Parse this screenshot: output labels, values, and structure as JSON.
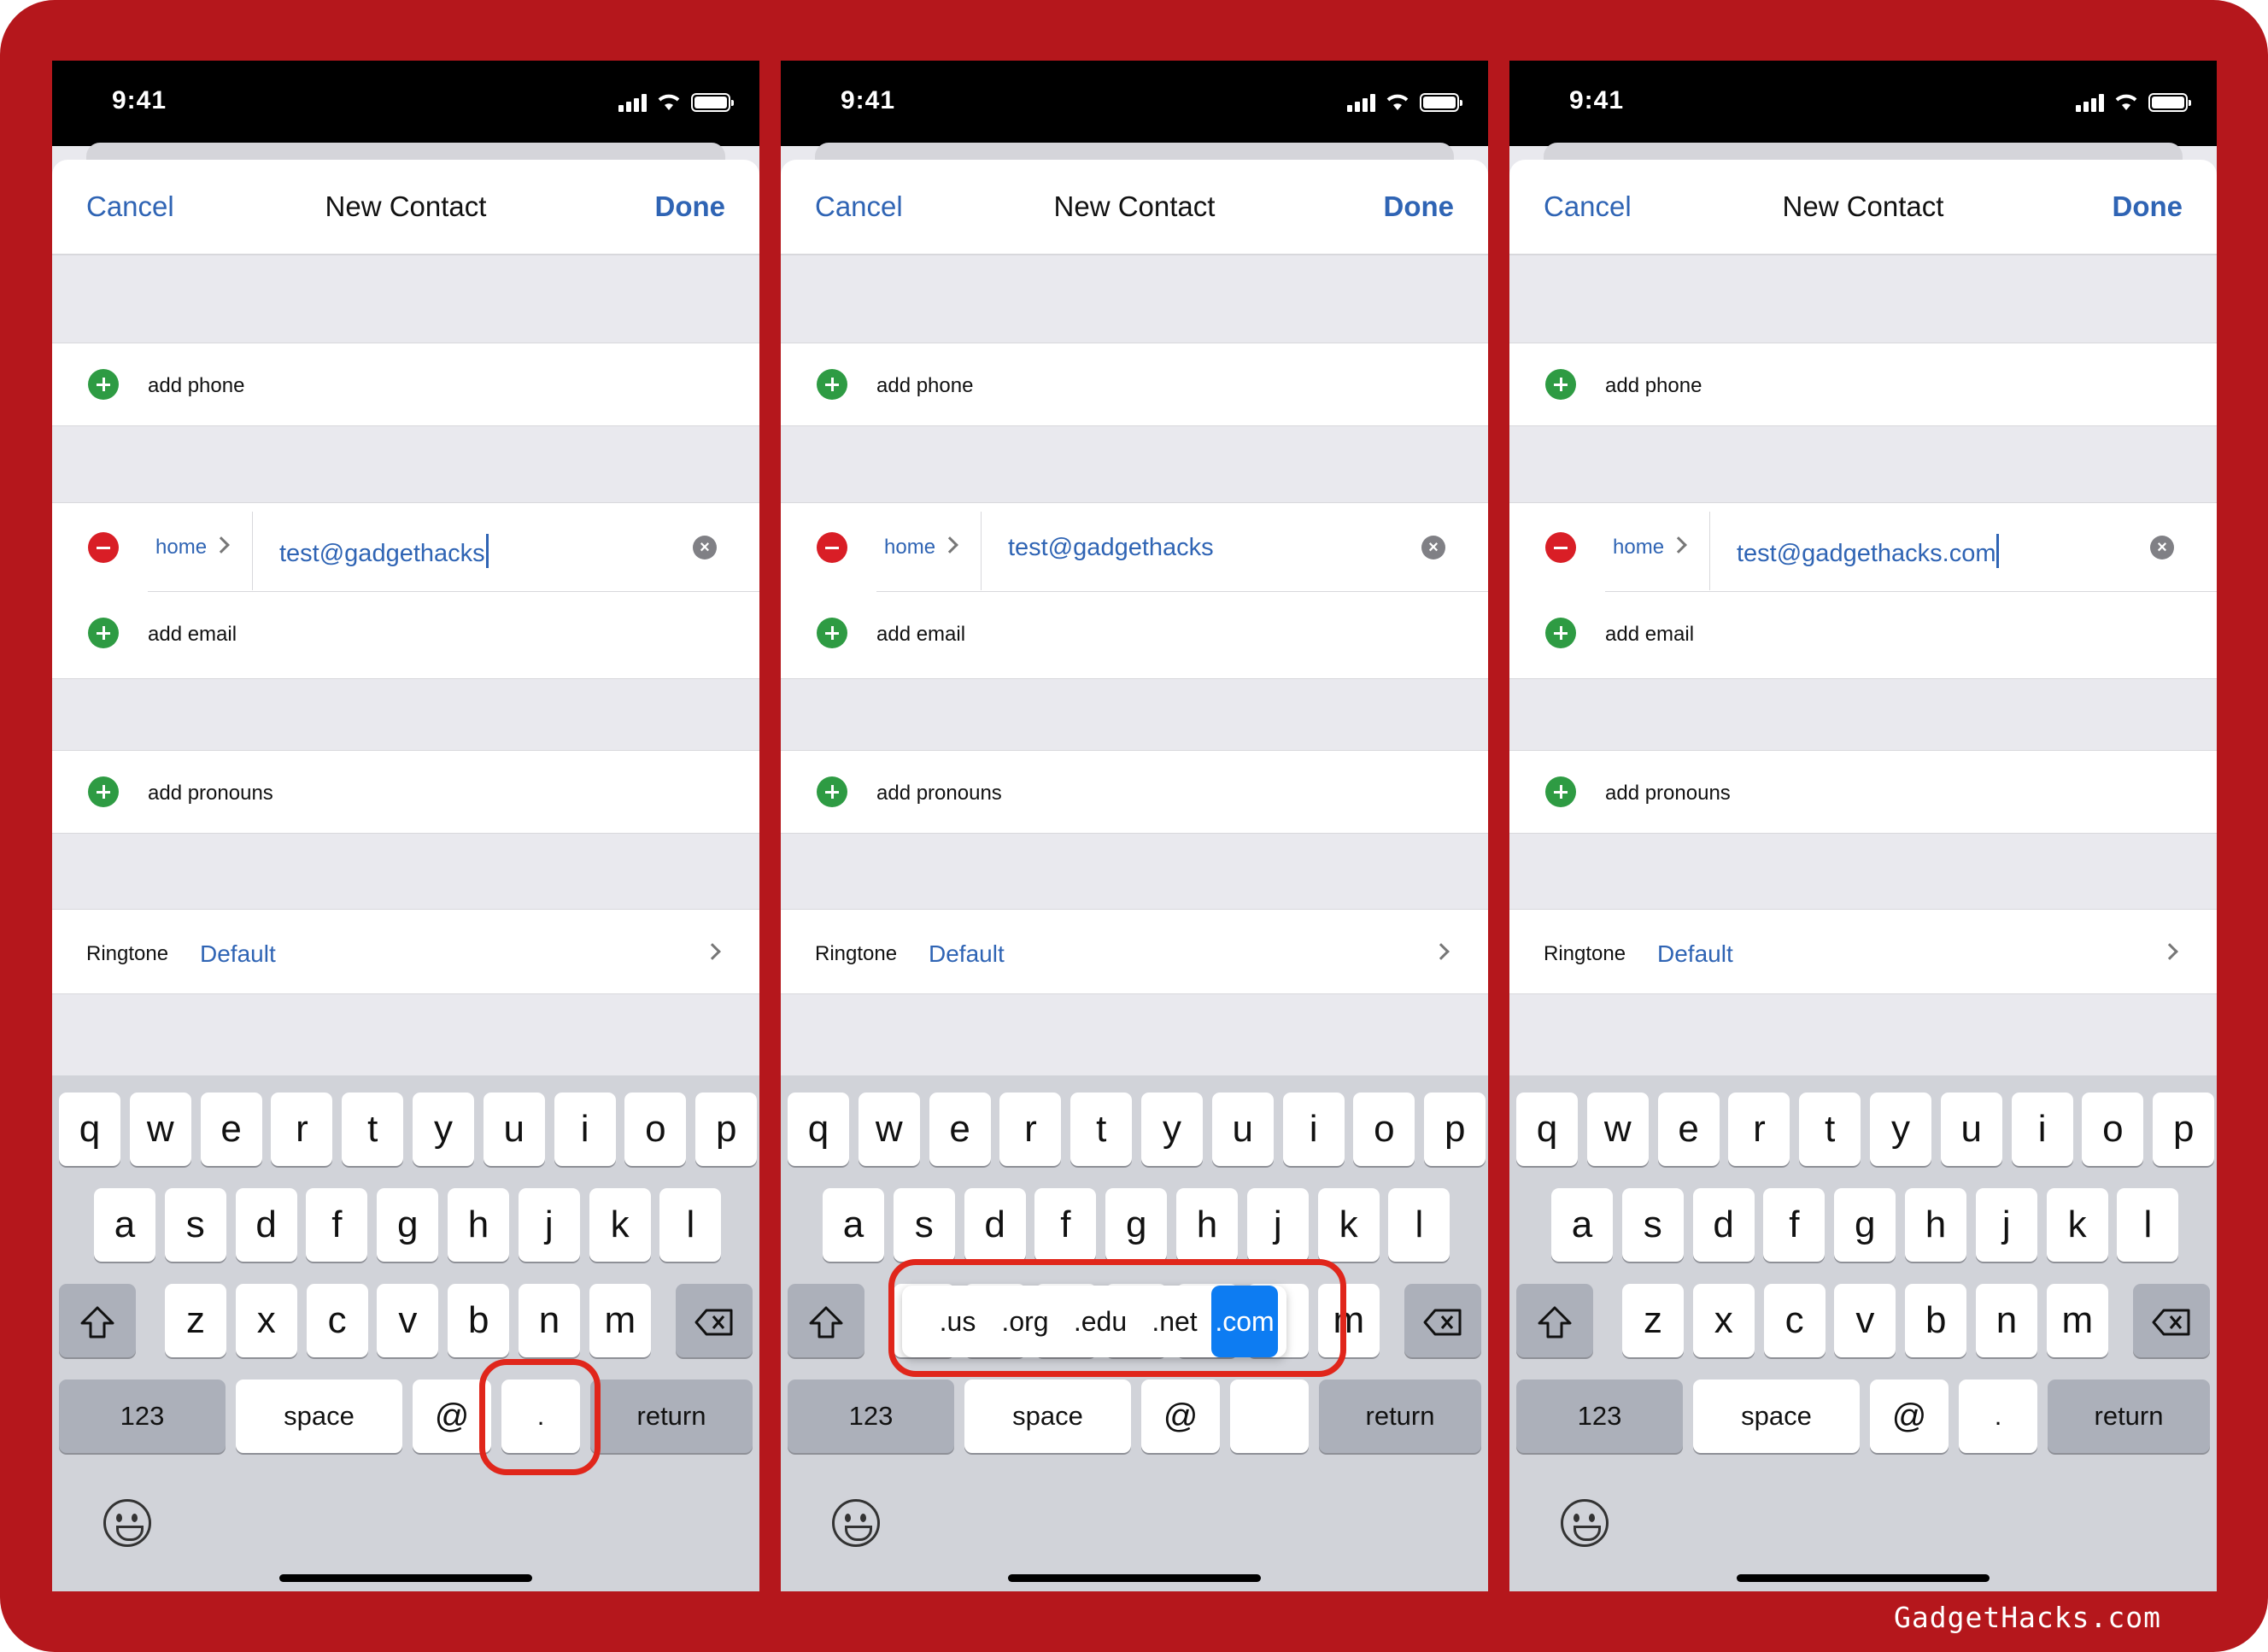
{
  "status": {
    "time": "9:41"
  },
  "nav": {
    "cancel": "Cancel",
    "title": "New Contact",
    "done": "Done"
  },
  "form": {
    "add_phone": "add phone",
    "email_label": "home",
    "add_email": "add email",
    "add_pronouns": "add pronouns",
    "ringtone_label": "Ringtone",
    "ringtone_value": "Default"
  },
  "panels": [
    {
      "email_value": "test@gadgethacks"
    },
    {
      "email_value": "test@gadgethacks"
    },
    {
      "email_value": "test@gadgethacks.com"
    }
  ],
  "keyboard": {
    "row1": [
      "q",
      "w",
      "e",
      "r",
      "t",
      "y",
      "u",
      "i",
      "o",
      "p"
    ],
    "row2": [
      "a",
      "s",
      "d",
      "f",
      "g",
      "h",
      "j",
      "k",
      "l"
    ],
    "row3": [
      "z",
      "x",
      "c",
      "v",
      "b",
      "n",
      "m"
    ],
    "numbers": "123",
    "space": "space",
    "at": "@",
    "dot": ".",
    "return": "return"
  },
  "domain_popup": [
    ".us",
    ".org",
    ".edu",
    ".net",
    ".com"
  ],
  "watermark": "GadgetHacks.com",
  "colors": {
    "frame": "#b5171c",
    "accent": "#2f64b4",
    "highlight": "#e0261b",
    "selected": "#0d7cf2"
  }
}
